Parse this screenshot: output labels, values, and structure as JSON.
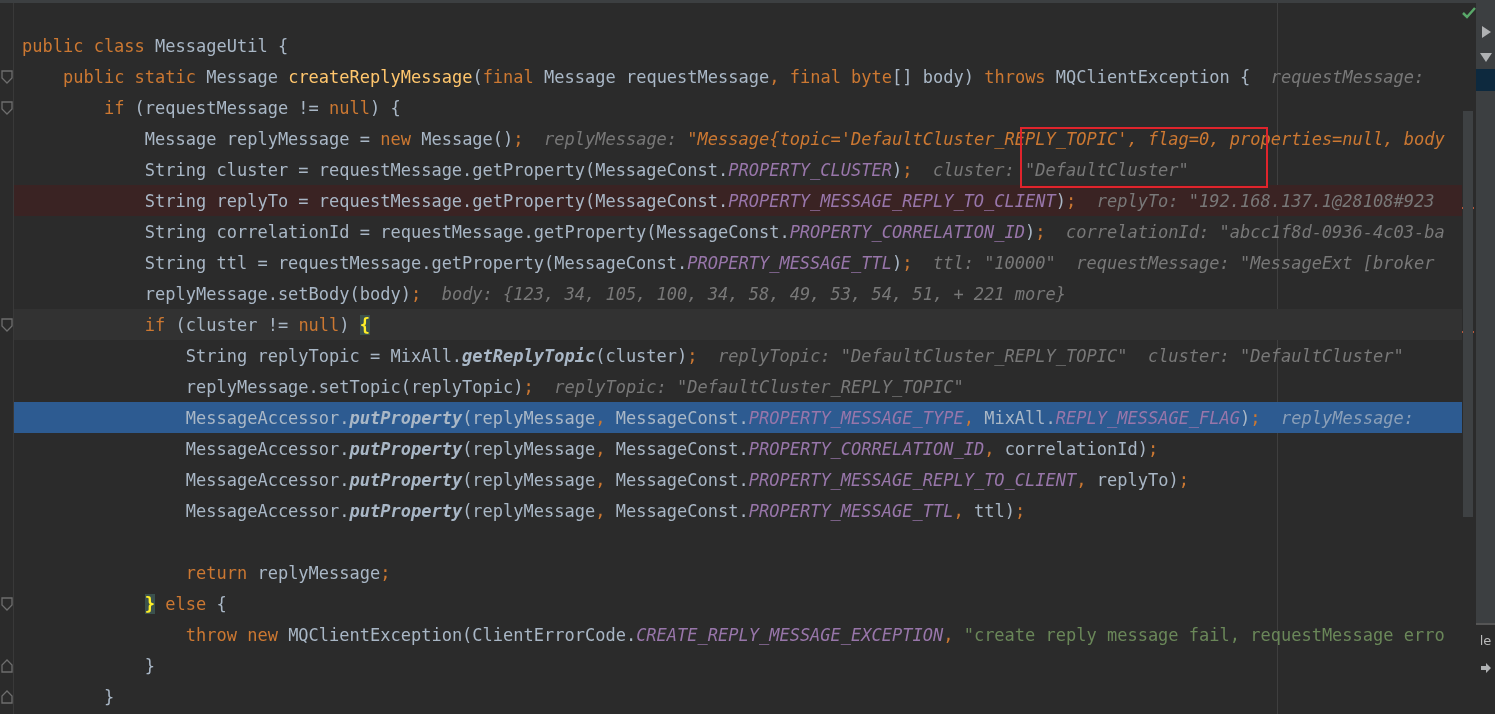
{
  "editor": {
    "lines": [
      {
        "kind": "plain",
        "code": [
          {
            "text": "public class ",
            "kind": "kw"
          },
          {
            "text": "MessageUtil {",
            "kind": "id"
          }
        ]
      },
      {
        "kind": "plain",
        "fold_start": true,
        "code": [
          {
            "text": "    public static ",
            "kind": "kw"
          },
          {
            "text": "Message ",
            "kind": "id"
          },
          {
            "text": "createReplyMessage",
            "kind": "decl"
          },
          {
            "text": "(",
            "kind": "id"
          },
          {
            "text": "final ",
            "kind": "kw"
          },
          {
            "text": "Message requestMessage",
            "kind": "id"
          },
          {
            "text": ", ",
            "kind": "punct"
          },
          {
            "text": "final byte",
            "kind": "kw"
          },
          {
            "text": "[] body) ",
            "kind": "id"
          },
          {
            "text": "throws ",
            "kind": "kw"
          },
          {
            "text": "MQClientException {",
            "kind": "id"
          }
        ],
        "hints": [
          [
            {
              "text": "requestMessage:",
              "kind": "hint"
            }
          ]
        ]
      },
      {
        "kind": "plain",
        "fold_start": true,
        "code": [
          {
            "text": "        if ",
            "kind": "kw"
          },
          {
            "text": "(requestMessage != ",
            "kind": "id"
          },
          {
            "text": "null",
            "kind": "kw"
          },
          {
            "text": ") {",
            "kind": "id"
          }
        ]
      },
      {
        "kind": "plain",
        "code": [
          {
            "text": "            Message replyMessage = ",
            "kind": "id"
          },
          {
            "text": "new ",
            "kind": "kw"
          },
          {
            "text": "Message()",
            "kind": "id"
          },
          {
            "text": ";",
            "kind": "punct"
          }
        ],
        "hints": [
          [
            {
              "text": "replyMessage: ",
              "kind": "hint"
            },
            {
              "text": "\"Message{topic='DefaultCluster_REPLY_TOPIC', flag=0, properties=null, body",
              "kind": "hintval"
            }
          ]
        ]
      },
      {
        "kind": "plain",
        "code": [
          {
            "text": "            String cluster = requestMessage.getProperty(MessageConst.",
            "kind": "id"
          },
          {
            "text": "PROPERTY_CLUSTER",
            "kind": "const"
          },
          {
            "text": ")",
            "kind": "id"
          },
          {
            "text": ";",
            "kind": "punct"
          }
        ],
        "hints": [
          [
            {
              "text": "cluster: \"DefaultCluster\"",
              "kind": "hint"
            }
          ]
        ]
      },
      {
        "kind": "breakpoint",
        "code": [
          {
            "text": "            String replyTo = requestMessage.getProperty(MessageConst.",
            "kind": "id"
          },
          {
            "text": "PROPERTY_MESSAGE_REPLY_TO_CLIENT",
            "kind": "const"
          },
          {
            "text": ")",
            "kind": "id"
          },
          {
            "text": ";",
            "kind": "punct"
          }
        ],
        "hints": [
          [
            {
              "text": "replyTo: \"192.168.137.1@28108#923",
              "kind": "hint"
            }
          ]
        ]
      },
      {
        "kind": "plain",
        "code": [
          {
            "text": "            String correlationId = requestMessage.getProperty(MessageConst.",
            "kind": "id"
          },
          {
            "text": "PROPERTY_CORRELATION_ID",
            "kind": "const"
          },
          {
            "text": ")",
            "kind": "id"
          },
          {
            "text": ";",
            "kind": "punct"
          }
        ],
        "hints": [
          [
            {
              "text": "correlationId: \"abcc1f8d-0936-4c03-ba",
              "kind": "hint"
            }
          ]
        ]
      },
      {
        "kind": "plain",
        "code": [
          {
            "text": "            String ttl = requestMessage.getProperty(MessageConst.",
            "kind": "id"
          },
          {
            "text": "PROPERTY_MESSAGE_TTL",
            "kind": "const"
          },
          {
            "text": ")",
            "kind": "id"
          },
          {
            "text": ";",
            "kind": "punct"
          }
        ],
        "hints": [
          [
            {
              "text": "ttl: \"10000\"",
              "kind": "hint"
            }
          ],
          [
            {
              "text": "requestMessage: \"MessageExt [broker",
              "kind": "hint"
            }
          ]
        ]
      },
      {
        "kind": "plain",
        "code": [
          {
            "text": "            replyMessage.setBody(body)",
            "kind": "id"
          },
          {
            "text": ";",
            "kind": "punct"
          }
        ],
        "hints": [
          [
            {
              "text": "body: {123, 34, 105, 100, 34, 58, 49, 53, 54, 51, + 221 more}",
              "kind": "hint"
            }
          ]
        ]
      },
      {
        "kind": "caret",
        "fold_start": true,
        "code": [
          {
            "text": "            if ",
            "kind": "kw"
          },
          {
            "text": "(cluster != ",
            "kind": "id"
          },
          {
            "text": "null",
            "kind": "kw"
          },
          {
            "text": ") ",
            "kind": "id"
          },
          {
            "text": "{",
            "kind": "brace"
          }
        ]
      },
      {
        "kind": "plain",
        "code": [
          {
            "text": "                String replyTopic = MixAll.",
            "kind": "id"
          },
          {
            "text": "getReplyTopic",
            "kind": "static"
          },
          {
            "text": "(cluster)",
            "kind": "id"
          },
          {
            "text": ";",
            "kind": "punct"
          }
        ],
        "hints": [
          [
            {
              "text": "replyTopic: \"DefaultCluster_REPLY_TOPIC\"",
              "kind": "hint"
            }
          ],
          [
            {
              "text": "cluster: \"DefaultCluster\"",
              "kind": "hint"
            }
          ]
        ]
      },
      {
        "kind": "plain",
        "code": [
          {
            "text": "                replyMessage.setTopic(replyTopic)",
            "kind": "id"
          },
          {
            "text": ";",
            "kind": "punct"
          }
        ],
        "hints": [
          [
            {
              "text": "replyTopic: \"DefaultCluster_REPLY_TOPIC\"",
              "kind": "hint"
            }
          ]
        ]
      },
      {
        "kind": "execution",
        "code": [
          {
            "text": "                MessageAccessor.",
            "kind": "id"
          },
          {
            "text": "putProperty",
            "kind": "static"
          },
          {
            "text": "(replyMessage",
            "kind": "id"
          },
          {
            "text": ", ",
            "kind": "punct"
          },
          {
            "text": "MessageConst.",
            "kind": "id"
          },
          {
            "text": "PROPERTY_MESSAGE_TYPE",
            "kind": "const"
          },
          {
            "text": ", ",
            "kind": "punct"
          },
          {
            "text": "MixAll.",
            "kind": "id"
          },
          {
            "text": "REPLY_MESSAGE_FLAG",
            "kind": "const"
          },
          {
            "text": ")",
            "kind": "id"
          },
          {
            "text": ";",
            "kind": "punct"
          }
        ],
        "hints": [
          [
            {
              "text": "replyMessage:",
              "kind": "hint"
            }
          ]
        ]
      },
      {
        "kind": "plain",
        "code": [
          {
            "text": "                MessageAccessor.",
            "kind": "id"
          },
          {
            "text": "putProperty",
            "kind": "static"
          },
          {
            "text": "(replyMessage",
            "kind": "id"
          },
          {
            "text": ", ",
            "kind": "punct"
          },
          {
            "text": "MessageConst.",
            "kind": "id"
          },
          {
            "text": "PROPERTY_CORRELATION_ID",
            "kind": "const"
          },
          {
            "text": ", ",
            "kind": "punct"
          },
          {
            "text": "correlationId)",
            "kind": "id"
          },
          {
            "text": ";",
            "kind": "punct"
          }
        ]
      },
      {
        "kind": "plain",
        "code": [
          {
            "text": "                MessageAccessor.",
            "kind": "id"
          },
          {
            "text": "putProperty",
            "kind": "static"
          },
          {
            "text": "(replyMessage",
            "kind": "id"
          },
          {
            "text": ", ",
            "kind": "punct"
          },
          {
            "text": "MessageConst.",
            "kind": "id"
          },
          {
            "text": "PROPERTY_MESSAGE_REPLY_TO_CLIENT",
            "kind": "const"
          },
          {
            "text": ", ",
            "kind": "punct"
          },
          {
            "text": "replyTo)",
            "kind": "id"
          },
          {
            "text": ";",
            "kind": "punct"
          }
        ]
      },
      {
        "kind": "plain",
        "code": [
          {
            "text": "                MessageAccessor.",
            "kind": "id"
          },
          {
            "text": "putProperty",
            "kind": "static"
          },
          {
            "text": "(replyMessage",
            "kind": "id"
          },
          {
            "text": ", ",
            "kind": "punct"
          },
          {
            "text": "MessageConst.",
            "kind": "id"
          },
          {
            "text": "PROPERTY_MESSAGE_TTL",
            "kind": "const"
          },
          {
            "text": ", ",
            "kind": "punct"
          },
          {
            "text": "ttl)",
            "kind": "id"
          },
          {
            "text": ";",
            "kind": "punct"
          }
        ]
      },
      {
        "kind": "plain"
      },
      {
        "kind": "plain",
        "code": [
          {
            "text": "                return ",
            "kind": "kw"
          },
          {
            "text": "replyMessage",
            "kind": "id"
          },
          {
            "text": ";",
            "kind": "punct"
          }
        ]
      },
      {
        "kind": "plain",
        "fold_start": true,
        "code": [
          {
            "text": "            }",
            "kind": "brace"
          },
          {
            "text": " else ",
            "kind": "kw"
          },
          {
            "text": "{",
            "kind": "id"
          }
        ]
      },
      {
        "kind": "plain",
        "code": [
          {
            "text": "                throw new ",
            "kind": "kw"
          },
          {
            "text": "MQClientException(ClientErrorCode.",
            "kind": "id"
          },
          {
            "text": "CREATE_REPLY_MESSAGE_EXCEPTION",
            "kind": "const"
          },
          {
            "text": ", ",
            "kind": "punct"
          },
          {
            "text": "\"create reply message fail, requestMessage erro",
            "kind": "str"
          }
        ]
      },
      {
        "kind": "plain",
        "fold_end": true,
        "code": [
          {
            "text": "            }",
            "kind": "id"
          }
        ]
      },
      {
        "kind": "plain",
        "fold_end": true,
        "code": [
          {
            "text": "        }",
            "kind": "id"
          }
        ]
      }
    ]
  },
  "side_panel": {
    "label": "le"
  }
}
